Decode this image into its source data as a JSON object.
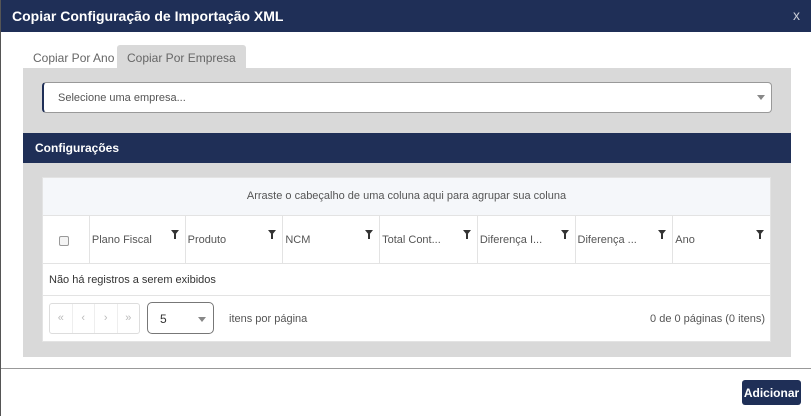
{
  "dialog": {
    "title": "Copiar Configuração de Importação XML",
    "close_label": "x"
  },
  "tabs": [
    {
      "label": "Copiar Por Ano",
      "active": false
    },
    {
      "label": "Copiar Por Empresa",
      "active": true
    }
  ],
  "company_select": {
    "placeholder": "Selecione uma empresa..."
  },
  "section": {
    "title": "Configurações"
  },
  "grid": {
    "group_hint": "Arraste o cabeçalho de uma coluna aqui para agrupar sua coluna",
    "columns": [
      "Plano Fiscal",
      "Produto",
      "NCM",
      "Total Cont...",
      "Diferença I...",
      "Diferença ...",
      "Ano"
    ],
    "empty_message": "Não há registros a serem exibidos",
    "pager": {
      "first": "«",
      "prev": "‹",
      "next": "›",
      "last": "»",
      "page_size": "5",
      "page_size_label": "itens por página",
      "info": "0 de 0 páginas (0 itens)"
    }
  },
  "footer": {
    "add_label": "Adicionar"
  },
  "colors": {
    "primary": "#1f2f57",
    "panel": "#d9d9d9"
  }
}
